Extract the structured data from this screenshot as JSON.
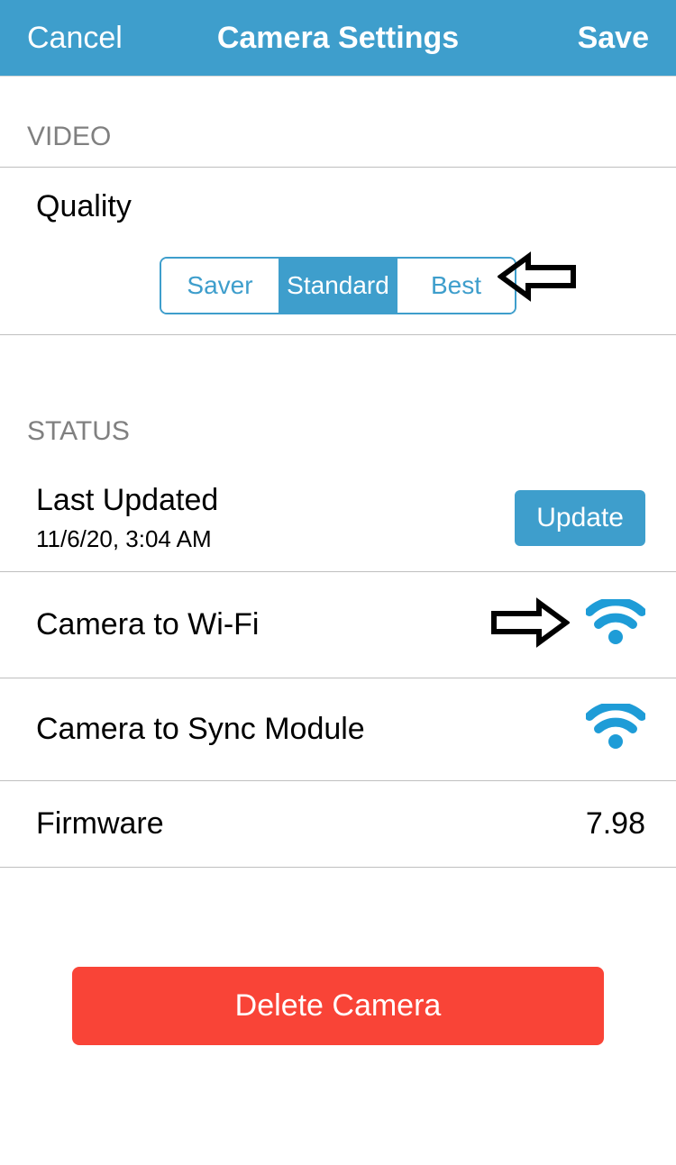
{
  "nav": {
    "cancel": "Cancel",
    "title": "Camera Settings",
    "save": "Save"
  },
  "video": {
    "header": "VIDEO",
    "quality_label": "Quality",
    "options": {
      "saver": "Saver",
      "standard": "Standard",
      "best": "Best"
    }
  },
  "status": {
    "header": "STATUS",
    "last_updated_label": "Last Updated",
    "last_updated_time": "11/6/20, 3:04 AM",
    "update_button": "Update",
    "camera_wifi_label": "Camera to Wi-Fi",
    "camera_sync_label": "Camera to Sync Module",
    "firmware_label": "Firmware",
    "firmware_value": "7.98"
  },
  "actions": {
    "delete": "Delete Camera"
  },
  "colors": {
    "primary": "#3e9ecc",
    "danger": "#f94437"
  }
}
